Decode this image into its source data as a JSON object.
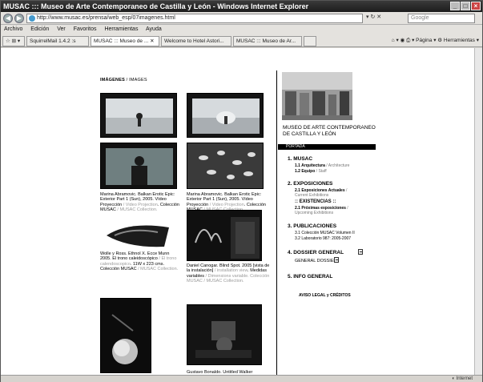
{
  "window": {
    "title": "MUSAC ::: Museo de Arte Contemporaneo de Castilla y León - Windows Internet Explorer"
  },
  "address": {
    "url": "http://www.musac.es/prensa/web_esp/07imagenes.html",
    "search_placeholder": "Google"
  },
  "menu": [
    "Edición",
    "Ver",
    "Favoritos",
    "Herramientas",
    "Ayuda"
  ],
  "menu_first": "Archivo",
  "tabs": [
    {
      "label": "SquirrelMail 1.4.2 :s"
    },
    {
      "label": "MUSAC ::: Museo de ...",
      "active": true
    },
    {
      "label": "Welcome to Hotel Astori..."
    },
    {
      "label": "MUSAC ::: Museo de Ar..."
    }
  ],
  "tools": {
    "page": "Página",
    "tools": "Herramientas"
  },
  "status": {
    "left": "",
    "right": "Internet"
  },
  "page": {
    "breadcrumb_bold": "IMÁGENES",
    "breadcrumb_rest": " / IMAGES",
    "captions": [
      {
        "black": "Marina Abramovic. Balkan Erotic Epic: Exterior Part 1 (Sun), 2005. Vídeo Proyección",
        "grey": " / Video Projection",
        "black2": ". Colección MUSAC",
        "grey2": " / MUSAC Collection."
      },
      {
        "black": "Marina Abramovic. Balkan Erotic Epic: Exterior Part 1 (Sun), 2005. Vídeo Proyección",
        "grey": " / Video Projection",
        "black2": ". Colección MUSAC",
        "grey2": " / MUSAC Collection."
      },
      {
        "black": "Wolle y Ross. Ethnol X. Ecce Munn 2005. El trono caleidoscópico",
        "grey": " / El trono calendoscopico",
        "black2": ". 11W x 223 cms. Colección MUSAC",
        "grey2": " / MUSAC Collection."
      },
      {
        "black": "Daniel Canogar. Blind Spot. 2005 [vista de la instalación]",
        "grey": " / installation view",
        "black2": ". Medidas variables",
        "grey2": " / Dimensions variable. Colección MUSAC / MUSAC Collection."
      }
    ],
    "bottom_caption": "Gustavo Bonaldo. Untitled Walker"
  },
  "sidebar": {
    "museum_name_line1": "MUSEO DE ARTE CONTEMPORANEO",
    "museum_name_line2": "DE CASTILLA Y LEÓN",
    "portada": "PORTADA",
    "sections": [
      {
        "num": "1.",
        "title": "MUSAC",
        "subs": [
          {
            "bold": "1.1 Arquitectura",
            "grey": " / Architecture"
          },
          {
            "bold": "1.2 Equipo",
            "grey": " / Staff"
          }
        ]
      },
      {
        "num": "2.",
        "title": "EXPOSICIONES",
        "subs": [
          {
            "bold": "2.1 Exposiciones Actuales",
            "grey": " / Current Exhibitions"
          },
          {
            "bold": ":: EXISTENCIAS ::",
            "grey": ""
          },
          {
            "bold": "2.1 Próximas exposiciones",
            "grey": " / Upcoming Exhibitions"
          }
        ]
      },
      {
        "num": "3.",
        "title": "PUBLICACIONES",
        "subs": [
          {
            "bold": "3.1 Colección MUSAC Volumen II",
            "grey": ""
          },
          {
            "bold": "3.2 Laboratorio 987: 2005-2007",
            "grey": ""
          }
        ]
      },
      {
        "num": "4.",
        "title": "DOSSIER GENERAL",
        "subs": [
          {
            "bold": "GENERAL DOSSIER",
            "grey": ""
          }
        ]
      },
      {
        "num": "5.",
        "title": "INFO GENERAL",
        "subs": []
      }
    ],
    "legal": "AVISO LEGAL y CRÉDITOS"
  },
  "colors": {
    "titlebar": "#262626",
    "black": "#000000",
    "grey_text": "#9a9a9a"
  }
}
